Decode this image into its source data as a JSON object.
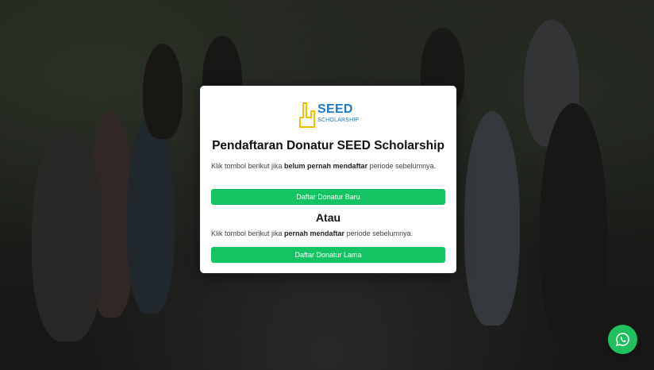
{
  "logo": {
    "main": "SEED",
    "sub": "SCHOLARSHIP",
    "color": "#1f77c9",
    "accent": "#f2c200"
  },
  "modal": {
    "title": "Pendaftaran Donatur SEED Scholarship",
    "new_desc_prefix": "Klik tombol berikut jika ",
    "new_desc_bold": "belum pernah mendaftar",
    "new_desc_suffix": " periode sebelumnya.",
    "new_button": "Daftar Donatur Baru",
    "separator": "Atau",
    "old_desc_prefix": "Klik tombol berikut jika ",
    "old_desc_bold": "pernah mendaftar",
    "old_desc_suffix": " periode sebelumnya.",
    "old_button": "Daftar Donatur Lama"
  },
  "colors": {
    "button": "#14c463",
    "whatsapp": "#1fc15e"
  },
  "whatsapp": {
    "icon": "whatsapp-icon"
  }
}
